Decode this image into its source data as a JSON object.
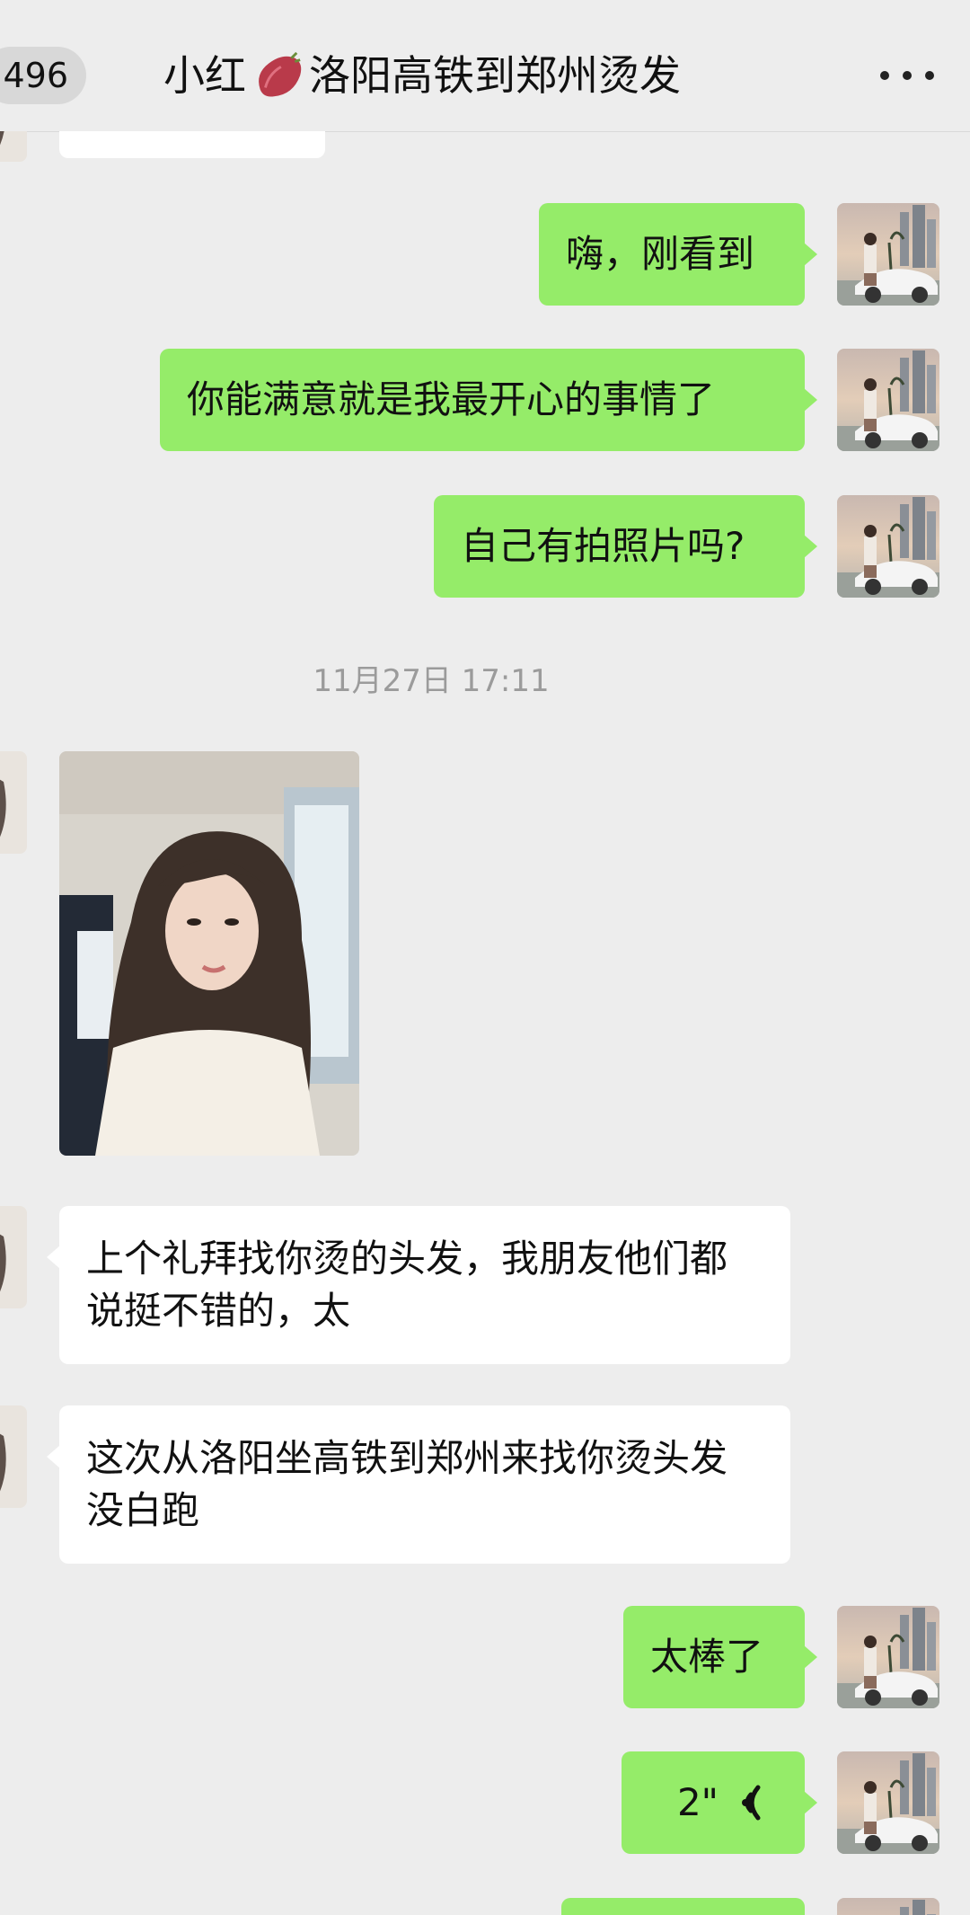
{
  "header": {
    "back_count": "496",
    "title_part1": "小红",
    "title_part2": "洛阳高铁到郑州烫发",
    "title_emoji_icon": "sweet-potato-icon",
    "more_icon": "more-icon"
  },
  "messages": {
    "m1": "嗨，刚看到",
    "m2": "你能满意就是我最开心的事情了",
    "m3": "自己有拍照片吗?",
    "timestamp": "11月27日 17:11",
    "m5": "上个礼拜找你烫的头发，我朋友他们都说挺不错的，太",
    "m6": "这次从洛阳坐高铁到郑州来找你烫头发 没白跑",
    "m7": "太棒了",
    "voice_duration": "2\""
  },
  "colors": {
    "background": "#ededed",
    "sent_bubble": "#95ec69",
    "received_bubble": "#ffffff",
    "timestamp": "#9b9b9b"
  }
}
